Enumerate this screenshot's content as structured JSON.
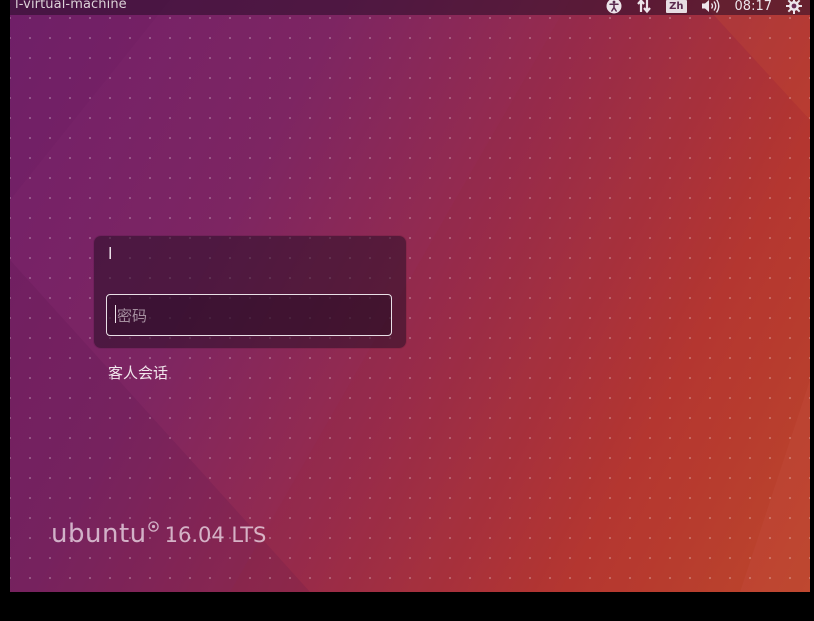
{
  "topbar": {
    "hostname": "l-virtual-machine",
    "keyboard_layout": "Zh",
    "clock": "08:17",
    "icons": [
      "accessibility-icon",
      "network-icon",
      "keyboard-layout-indicator",
      "volume-icon",
      "settings-gear-icon"
    ]
  },
  "login": {
    "username": "l",
    "password_placeholder": "密码",
    "guest_session_label": "客人会话"
  },
  "branding": {
    "wordmark": "ubuntu",
    "version": "16.04 LTS"
  },
  "colors": {
    "wallpaper_left": "#72206a",
    "wallpaper_right": "#c24a2a",
    "panel_text": "#dcd2d8",
    "input_border": "#e9dfe6"
  }
}
